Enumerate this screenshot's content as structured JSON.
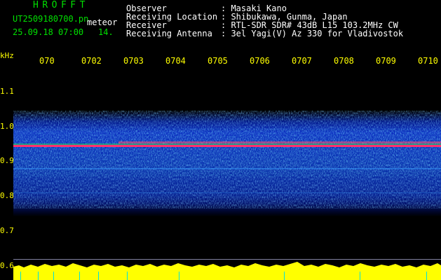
{
  "header": {
    "title": "HROFFT",
    "file_name": "UT2509180700.pn",
    "mode": "meteor",
    "date_time": "25.09.18 07:00",
    "count": "14."
  },
  "info": [
    {
      "label": "Observer",
      "value": ": Masaki Kano"
    },
    {
      "label": "Receiving Location",
      "value": ": Shibukawa, Gunma, Japan"
    },
    {
      "label": "Receiver",
      "value": ": RTL-SDR SDR# 43dB L15 103.2MHz CW"
    },
    {
      "label": "Receiving Antenna",
      "value": ": 3el Yagi(V) Az 330 for Vladivostok"
    }
  ],
  "axis": {
    "unit": "kHz",
    "y_ticks": [
      "1.1",
      "1.0",
      "0.9",
      "0.8",
      "0.7",
      "0.6"
    ],
    "x_ticks": [
      "070",
      "0702",
      "0703",
      "0704",
      "0705",
      "0706",
      "0707",
      "0708",
      "0709",
      "0710"
    ]
  },
  "colors": {
    "background": "#000000",
    "text_green": "#00e000",
    "text_white": "#ffffff",
    "axis_yellow": "#ffff00",
    "signal_band": "#ff3070"
  }
}
